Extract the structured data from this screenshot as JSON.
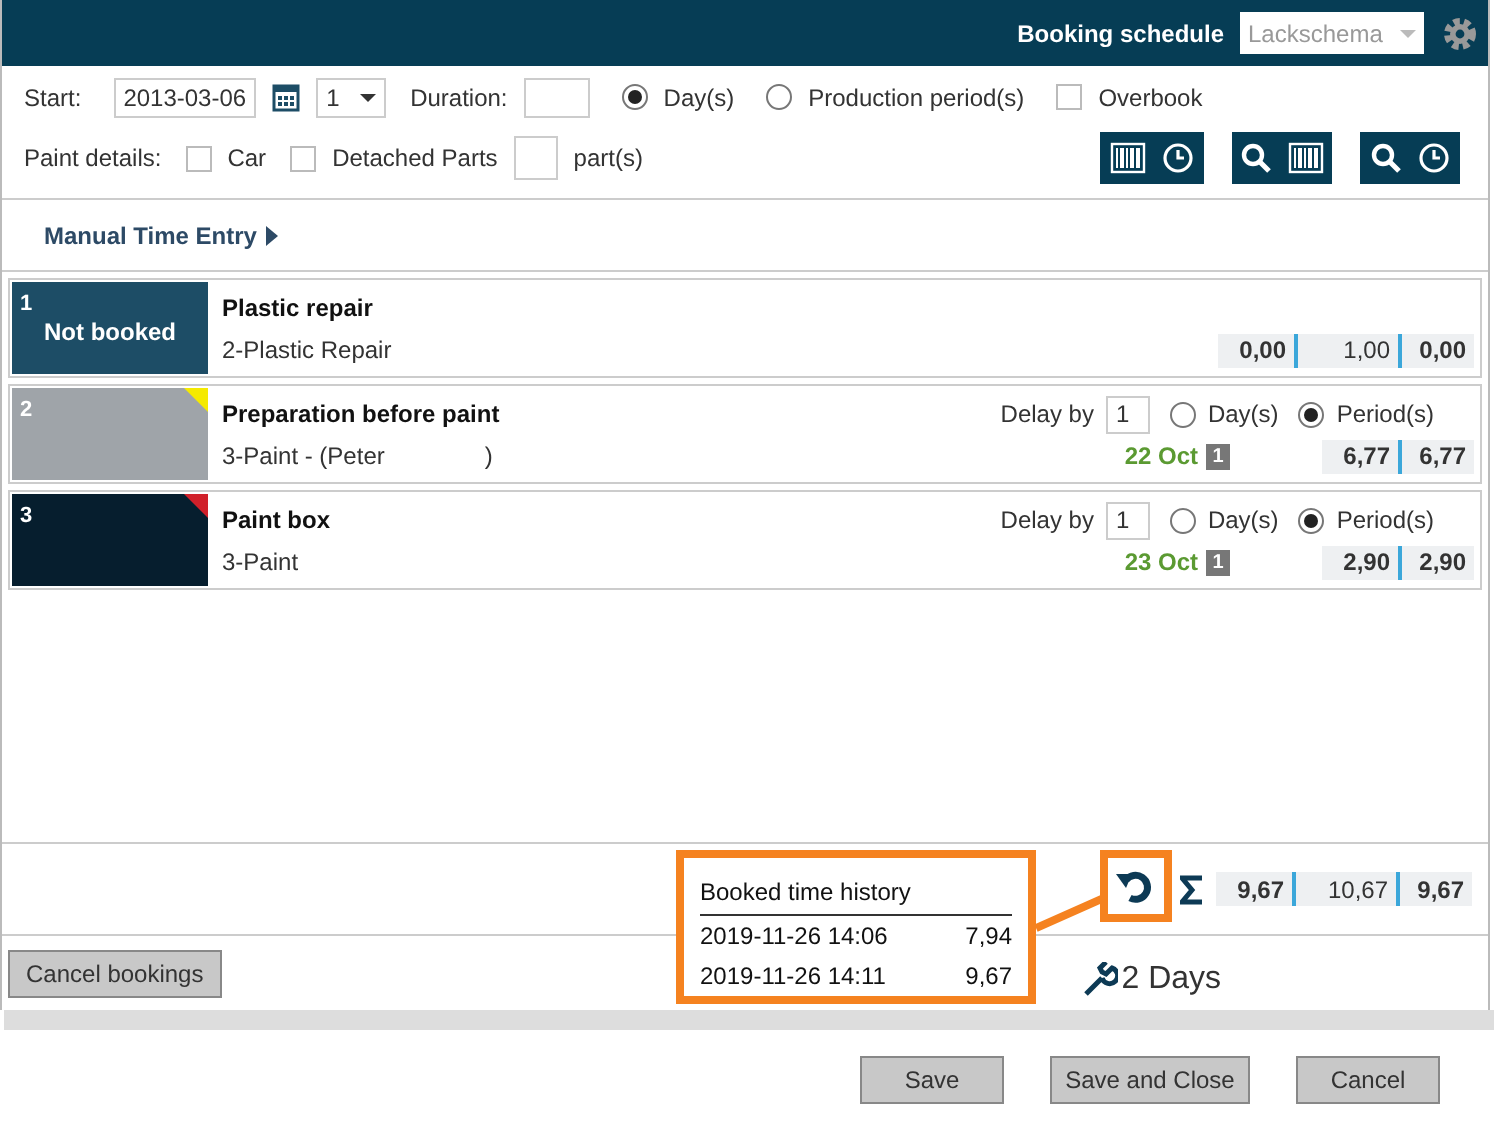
{
  "header": {
    "title": "Booking schedule",
    "schema": "Lackschema"
  },
  "start": {
    "label": "Start:",
    "date": "2013-03-06",
    "count": "1"
  },
  "duration": {
    "label": "Duration:",
    "options": [
      {
        "label": "Day(s)",
        "selected": true
      },
      {
        "label": "Production period(s)",
        "selected": false
      }
    ],
    "overbook": {
      "label": "Overbook",
      "checked": false
    }
  },
  "paint_details": {
    "label": "Paint details:",
    "options": [
      {
        "label": "Car",
        "checked": false
      },
      {
        "label": "Detached Parts",
        "checked": false
      }
    ],
    "parts_label": "part(s)"
  },
  "manual_time_entry": "Manual Time Entry",
  "tasks": [
    {
      "number": "1",
      "status": "Not booked",
      "color": "#1d4d66",
      "title": "Plastic repair",
      "subtitle": "2-Plastic Repair",
      "values": [
        {
          "text": "0,00",
          "bold": true
        },
        {
          "text": "1,00",
          "bold": false
        },
        {
          "text": "0,00",
          "bold": true
        }
      ]
    },
    {
      "number": "2",
      "color": "#9fa4a9",
      "flag": {
        "color": "#f5ea00"
      },
      "title": "Preparation before paint",
      "subtitle": "3-Paint -  (Peter",
      "subtitle_end": ")",
      "delay": {
        "label": "Delay by",
        "value": "1",
        "options": [
          {
            "label": "Day(s)",
            "selected": false
          },
          {
            "label": "Period(s)",
            "selected": true
          }
        ]
      },
      "date": "22 Oct",
      "badge": "1",
      "values": [
        {
          "text": "6,77",
          "bold": true
        },
        {
          "text": "6,77",
          "bold": true
        }
      ]
    },
    {
      "number": "3",
      "color": "#061e2e",
      "flag": {
        "color": "#d0202a"
      },
      "title": "Paint box",
      "subtitle": "3-Paint",
      "delay": {
        "label": "Delay by",
        "value": "1",
        "options": [
          {
            "label": "Day(s)",
            "selected": false
          },
          {
            "label": "Period(s)",
            "selected": true
          }
        ]
      },
      "date": "23 Oct",
      "badge": "1",
      "values": [
        {
          "text": "2,90",
          "bold": true
        },
        {
          "text": "2,90",
          "bold": true
        }
      ]
    }
  ],
  "history": {
    "title": "Booked time history",
    "rows": [
      {
        "time": "2019-11-26 14:06",
        "value": "7,94"
      },
      {
        "time": "2019-11-26 14:11",
        "value": "9,67"
      }
    ]
  },
  "totals": [
    {
      "text": "9,67",
      "bold": true
    },
    {
      "text": "10,67",
      "bold": false
    },
    {
      "text": "9,67",
      "bold": true
    }
  ],
  "duration_summary": "2 Days",
  "cancel_bookings": "Cancel bookings",
  "buttons": [
    "Save",
    "Save and Close",
    "Cancel"
  ]
}
